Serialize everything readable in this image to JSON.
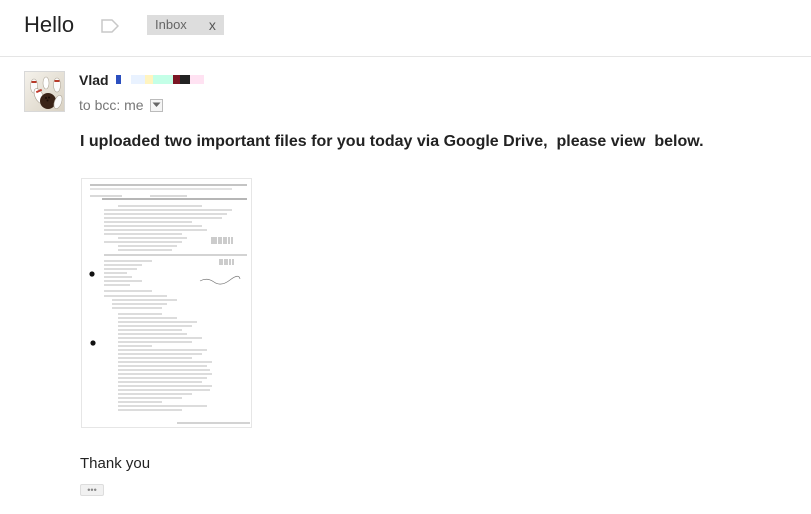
{
  "email": {
    "subject": "Hello",
    "label_icon": "label-tag-icon",
    "label": {
      "name": "Inbox",
      "remove": "x"
    },
    "sender": {
      "name": "Vlad",
      "avatar_icon": "bowling-pins-avatar"
    },
    "recipients": {
      "to_text": "to bcc: me",
      "details_icon": "chevron-down-icon"
    },
    "body": {
      "headline": "I uploaded two important files for you today via Google Drive,  please view  below.",
      "attachment_preview": "scanned-document-thumbnail",
      "closing": "Thank you",
      "trimmed_content_label": "•••"
    }
  },
  "colors": {
    "label_chip_bg": "#dddddd",
    "divider": "#e5e5e5",
    "text_primary": "#222222",
    "text_secondary": "#777777"
  }
}
